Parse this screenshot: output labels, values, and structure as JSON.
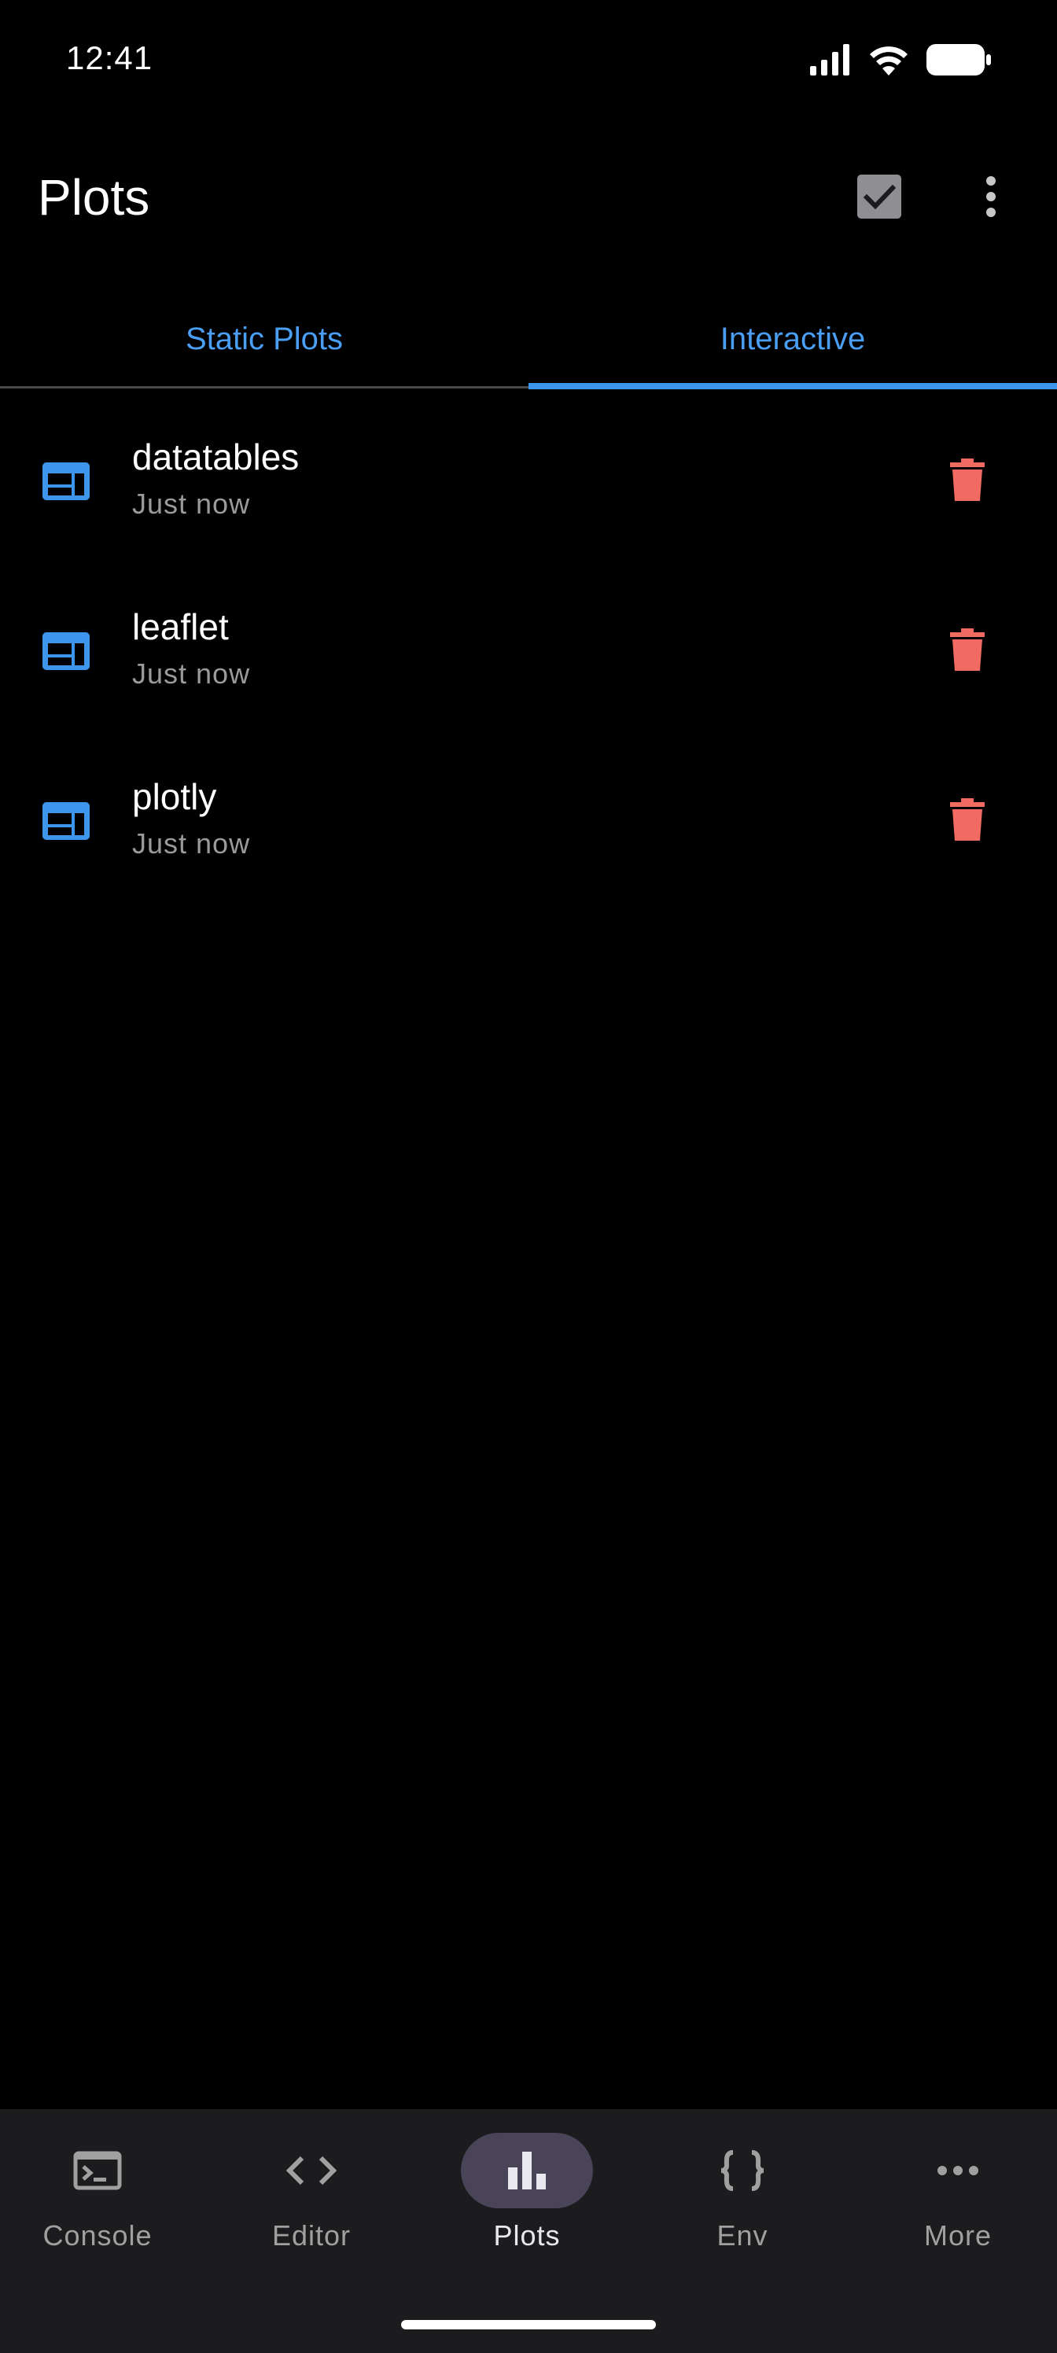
{
  "status_bar": {
    "time": "12:41",
    "icons": [
      "signal-icon",
      "wifi-icon",
      "battery-icon"
    ]
  },
  "app_bar": {
    "title": "Plots",
    "actions": [
      "select-all-icon",
      "more-vert-icon"
    ]
  },
  "tabs": [
    {
      "label": "Static Plots",
      "active": false
    },
    {
      "label": "Interactive",
      "active": true
    }
  ],
  "plots": [
    {
      "name": "datatables",
      "time": "Just now",
      "icon": "web-widget-icon"
    },
    {
      "name": "leaflet",
      "time": "Just now",
      "icon": "web-widget-icon"
    },
    {
      "name": "plotly",
      "time": "Just now",
      "icon": "web-widget-icon"
    }
  ],
  "bottom_nav": [
    {
      "label": "Console",
      "icon": "terminal-icon",
      "active": false
    },
    {
      "label": "Editor",
      "icon": "code-icon",
      "active": false
    },
    {
      "label": "Plots",
      "icon": "bar-chart-icon",
      "active": true
    },
    {
      "label": "Env",
      "icon": "braces-icon",
      "active": false
    },
    {
      "label": "More",
      "icon": "more-horiz-icon",
      "active": false
    }
  ],
  "colors": {
    "background": "#000000",
    "accent": "#4a9ff5",
    "delete": "#f26b63",
    "secondary_text": "#9a9a9a",
    "nav_background": "#1c1c1e",
    "nav_active_pill": "#4a4458"
  }
}
